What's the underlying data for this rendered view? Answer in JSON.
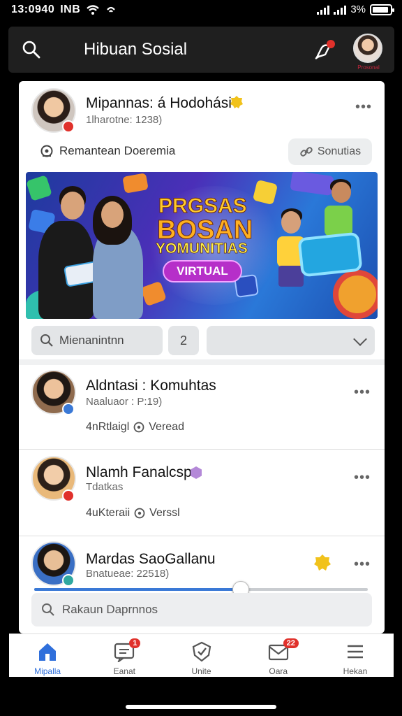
{
  "status_bar": {
    "time": "13:0940",
    "carrier": "INB",
    "battery": "3%"
  },
  "appbar": {
    "title": "Hibuan Sosial",
    "profile_label": "Prosonal"
  },
  "post_main": {
    "name": "Mipannas: á Hodohási",
    "subtitle": "1lharotne: 1238)",
    "remind_text": "Remantean Doeremia",
    "share_label": "Sonutias",
    "banner": {
      "line1": "PRGSAS",
      "line2": "BOSAN",
      "line3": "YOMUNITIAS",
      "pill": "VIRTUAL"
    },
    "search_tool": "Mienanintnn",
    "count_tool": "2"
  },
  "feed_items": [
    {
      "name": "Aldntasi : Komuhtas",
      "subtitle": "Naaluaor : P:19)",
      "meta_left": "4nRtlaigl",
      "meta_right": "Veread"
    },
    {
      "name": "Nlamh Fanalcsp",
      "subtitle": "Tdatkas",
      "meta_left": "4uKteraii",
      "meta_right": "Verssl"
    },
    {
      "name": "Mardas SaoGallanu",
      "subtitle": "Bnatueae: 22518)"
    }
  ],
  "slider": {
    "value": 0.62
  },
  "bottom_search": {
    "placeholder": "Rakaun Daprnnos"
  },
  "nav": [
    {
      "label": "Mipalla",
      "icon": "home-icon",
      "badge": ""
    },
    {
      "label": "Eanat",
      "icon": "chat-icon",
      "badge": "1"
    },
    {
      "label": "Unite",
      "icon": "shield-check-icon",
      "badge": ""
    },
    {
      "label": "Oara",
      "icon": "mail-icon",
      "badge": "22"
    },
    {
      "label": "Hekan",
      "icon": "menu-icon",
      "badge": ""
    }
  ],
  "colors": {
    "accent": "#2f6fdb",
    "badge_red": "#e0312b",
    "appbar": "#1f1f1f"
  }
}
